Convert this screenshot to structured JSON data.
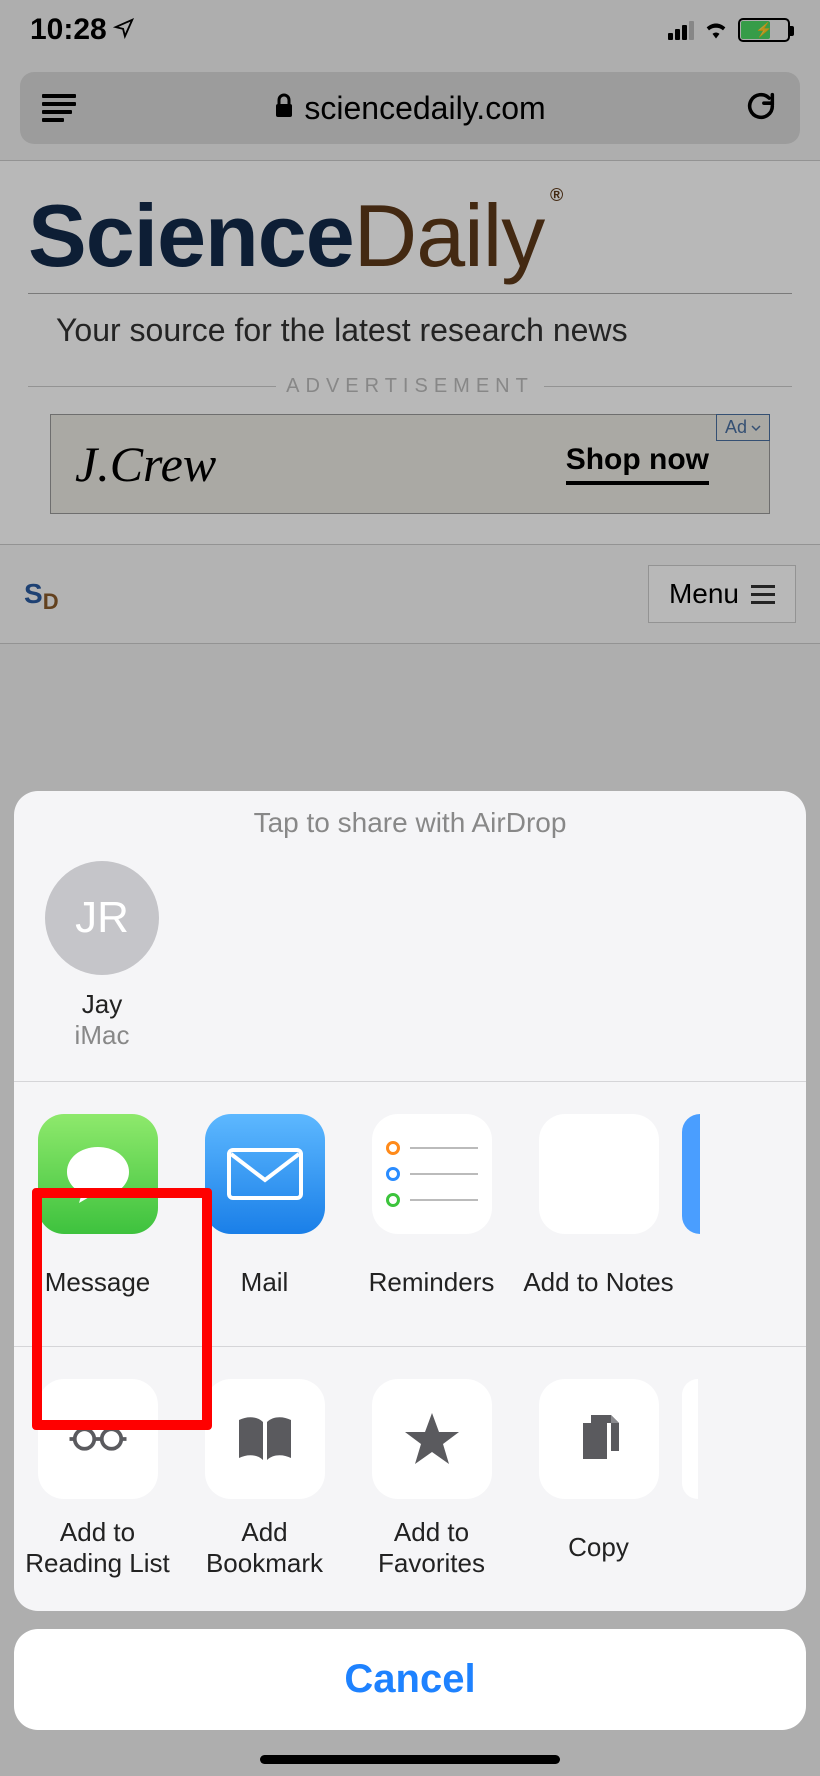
{
  "status": {
    "time": "10:28"
  },
  "urlbar": {
    "domain": "sciencedaily.com"
  },
  "site": {
    "logo_bold": "Science",
    "logo_light": "Daily",
    "tagline": "Your source for the latest research news",
    "ad_label": "ADVERTISEMENT",
    "ad_brand": "J.Crew",
    "ad_cta": "Shop now",
    "ad_badge": "Ad",
    "menu": "Menu"
  },
  "share": {
    "airdrop_title": "Tap to share with AirDrop",
    "airdrop": {
      "initials": "JR",
      "name": "Jay",
      "device": "iMac"
    },
    "apps": [
      {
        "label": "Message"
      },
      {
        "label": "Mail"
      },
      {
        "label": "Reminders"
      },
      {
        "label": "Add to Notes"
      }
    ],
    "actions": [
      {
        "label": "Add to Reading List"
      },
      {
        "label": "Add Bookmark"
      },
      {
        "label": "Add to Favorites"
      },
      {
        "label": "Copy"
      }
    ],
    "cancel": "Cancel"
  }
}
